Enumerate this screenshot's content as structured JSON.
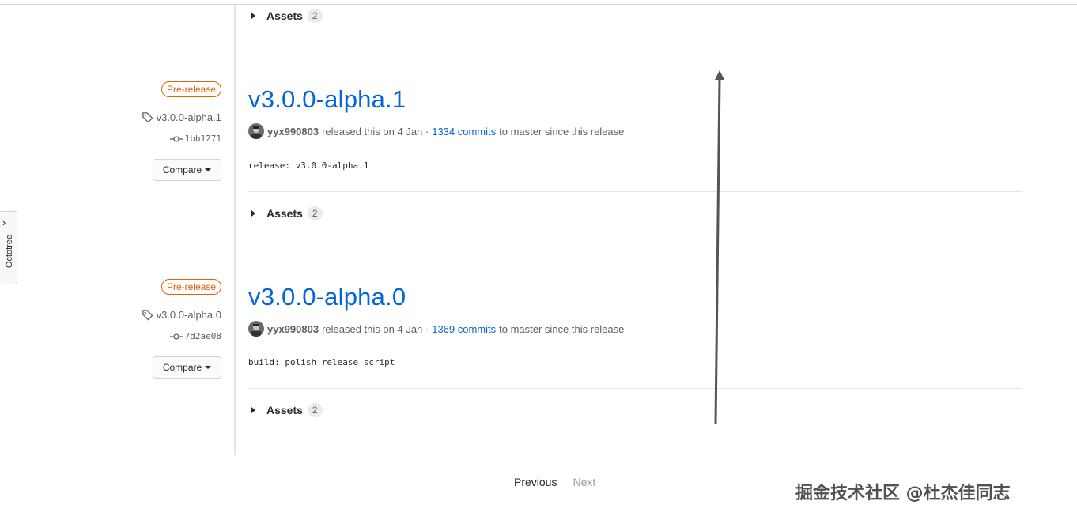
{
  "octotree": {
    "label": "Octotree",
    "chevron": "›"
  },
  "assets_label": "Assets",
  "asset_count": "2",
  "releases": [
    {
      "badge": "Pre-release",
      "tag": "v3.0.0-alpha.1",
      "commit": "1bb1271",
      "compare": "Compare",
      "title": "v3.0.0-alpha.1",
      "author": "yyx990803",
      "released_text": "released this on 4 Jan ·",
      "commits_link": "1334 commits",
      "since_text": "to master since this release",
      "body": "release: v3.0.0-alpha.1"
    },
    {
      "badge": "Pre-release",
      "tag": "v3.0.0-alpha.0",
      "commit": "7d2ae08",
      "compare": "Compare",
      "title": "v3.0.0-alpha.0",
      "author": "yyx990803",
      "released_text": "released this on 4 Jan ·",
      "commits_link": "1369 commits",
      "since_text": "to master since this release",
      "body": "build: polish release script"
    }
  ],
  "pagination": {
    "previous": "Previous",
    "next": "Next"
  },
  "watermark": "掘金技术社区 @杜杰佳同志",
  "colors": {
    "link": "#0366d6",
    "prerelease": "#e36209",
    "text_muted": "#586069"
  },
  "icons": {
    "tag": "tag-icon",
    "commit": "git-commit-icon",
    "caret": "triangle-right-icon",
    "arrow": "arrow-up-annotation"
  }
}
